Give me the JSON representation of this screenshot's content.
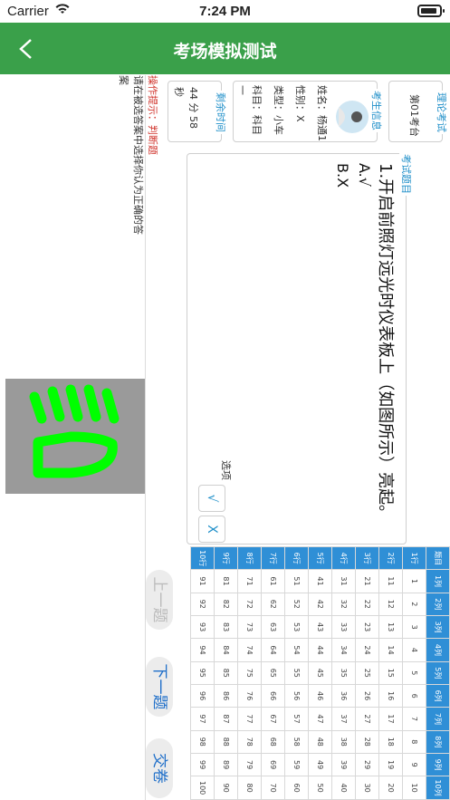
{
  "status": {
    "carrier": "Carrier",
    "time": "7:24 PM"
  },
  "header": {
    "title": "考场模拟测试"
  },
  "exam_card": {
    "label": "理论考试",
    "seat": "第01考台"
  },
  "student": {
    "label": "考生信息",
    "name": "姓名：杨通1",
    "gender": "性别：X",
    "type": "类型：小车",
    "subject": "科目：科目一"
  },
  "timer": {
    "label": "剩余时间",
    "value": "44 分 58 秒"
  },
  "tip": {
    "prefix": "操作提示：判断题",
    "text": "请在被选答案中选择你认为正确的答案"
  },
  "question": {
    "label": "考试题目",
    "text": "1.开启前照灯远光时仪表板上（如图所示）亮起。",
    "option_a": "A.√",
    "option_b": "B.X"
  },
  "answer": {
    "label": "选项",
    "choice_a": "√",
    "choice_b": "X"
  },
  "grid": {
    "col_headers": [
      "题目",
      "1列",
      "2列",
      "3列",
      "4列",
      "5列",
      "6列",
      "7列",
      "8列",
      "9列",
      "10列"
    ],
    "row_headers": [
      "1行",
      "2行",
      "3行",
      "4行",
      "5行",
      "6行",
      "7行",
      "8行",
      "9行",
      "10行"
    ]
  },
  "buttons": {
    "prev": "上一题",
    "next": "下一题",
    "submit": "交卷"
  },
  "colors": {
    "nav_green": "#3aa04a",
    "accent_blue": "#1f8fc9",
    "header_blue": "#2f8fd6",
    "warning_red": "#d0342c",
    "indicator_green": "#00ff00"
  }
}
